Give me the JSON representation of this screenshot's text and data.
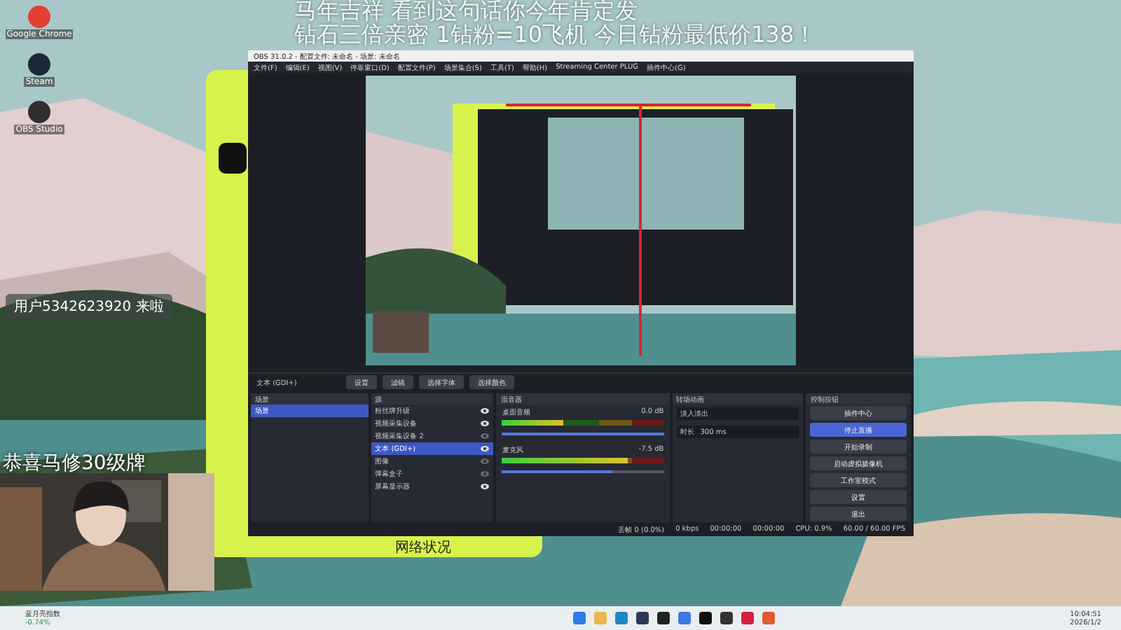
{
  "overlay_lines": [
    "马年吉祥 看到这句话你今年肯定发",
    "钻石三倍亲密 1钻粉=10飞机 今日钻粉最低价138！"
  ],
  "desktop_icons": [
    {
      "label": "Google Chrome",
      "color": "#e34133"
    },
    {
      "label": "Steam",
      "color": "#1b2838"
    },
    {
      "label": "OBS Studio",
      "color": "#302e31"
    }
  ],
  "chat_message": {
    "badge": "用户5342623920 来啦"
  },
  "gift_banner": "恭喜马修30级牌",
  "side_app": {
    "footer_text": "网络状况"
  },
  "obs": {
    "title": "OBS 31.0.2 - 配置文件: 未命名 - 场景: 未命名",
    "menu": [
      "文件(F)",
      "编辑(E)",
      "视图(V)",
      "停靠窗口(D)",
      "配置文件(P)",
      "场景集合(S)",
      "工具(T)",
      "帮助(H)",
      "Streaming Center PLUG",
      "插件中心(G)"
    ],
    "source_toolbar": {
      "source": "文本 (GDI+)",
      "buttons": [
        "设置",
        "滤镜",
        "选择字体",
        "选择颜色"
      ]
    },
    "scenes": {
      "title": "场景",
      "items": [
        {
          "label": "场景",
          "selected": true
        }
      ]
    },
    "sources": {
      "title": "源",
      "items": [
        {
          "label": "粉丝牌升级",
          "visible": true,
          "selected": false
        },
        {
          "label": "视频采集设备",
          "visible": true,
          "selected": false
        },
        {
          "label": "视频采集设备 2",
          "visible": false,
          "selected": false
        },
        {
          "label": "文本 (GDI+)",
          "visible": true,
          "selected": true
        },
        {
          "label": "图像",
          "visible": false,
          "selected": false
        },
        {
          "label": "弹幕盒子",
          "visible": false,
          "selected": false
        },
        {
          "label": "屏幕显示器",
          "visible": true,
          "selected": false
        }
      ]
    },
    "mixer": {
      "title": "混音器",
      "channels": [
        {
          "name": "桌面音频",
          "reading": "0.0 dB",
          "level": 0.38,
          "volume": {
            "level": 1.0
          }
        },
        {
          "name": "麦克风",
          "reading": "-7.5 dB",
          "level": 0.78,
          "volume": {
            "level": 0.68
          }
        }
      ]
    },
    "transitions": {
      "title": "转场动画",
      "transition": "淡入淡出",
      "duration_label": "时长",
      "duration": "300 ms"
    },
    "controls": {
      "title": "控制按钮",
      "buttons": [
        {
          "label": "插件中心",
          "highlighted": false
        },
        {
          "label": "停止直播",
          "highlighted": true
        },
        {
          "label": "开始录制",
          "highlighted": false
        },
        {
          "label": "启动虚拟摄像机",
          "highlighted": false
        },
        {
          "label": "工作室模式",
          "highlighted": false
        },
        {
          "label": "设置",
          "highlighted": false
        },
        {
          "label": "退出",
          "highlighted": false
        }
      ]
    },
    "status": [
      "丢帧 0 (0.0%)",
      "0 kbps",
      "00:00:00",
      "00:00:00",
      "CPU: 0.9%",
      "60.00 / 60.00 FPS"
    ]
  },
  "taskbar": {
    "widget_title": "蓝月亮指数",
    "widget_value": "-0.74%",
    "time": "10:04:51",
    "date": "2026/1/2"
  }
}
